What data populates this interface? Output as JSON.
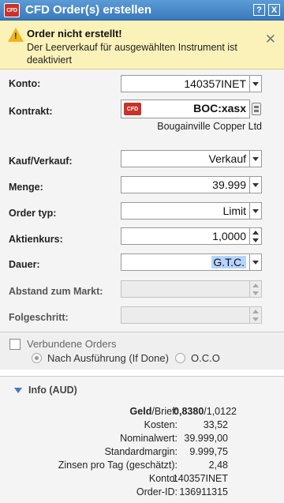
{
  "window": {
    "title": "CFD Order(s) erstellen",
    "app_badge": "CFD",
    "help_btn": "?",
    "close_btn": "X"
  },
  "alert": {
    "title": "Order nicht erstellt!",
    "message": "Der Leerverkauf für ausgewählten Instrument ist deaktiviert",
    "icon": "warning-icon",
    "close": "✕"
  },
  "form": {
    "account_label": "Konto:",
    "account_value": "140357INET",
    "contract_label": "Kontrakt:",
    "contract_badge": "CFD",
    "contract_symbol": "BOC:xasx",
    "contract_name": "Bougainville Copper Ltd",
    "side_label": "Kauf/Verkauf:",
    "side_value": "Verkauf",
    "qty_label": "Menge:",
    "qty_value": "39.999",
    "ordertype_label": "Order typ:",
    "ordertype_value": "Limit",
    "price_label": "Aktienkurs:",
    "price_value": "1,0000",
    "duration_label": "Dauer:",
    "duration_value": "G.T.C.",
    "distance_label": "Abstand zum Markt:",
    "distance_value": "",
    "trailing_label": "Folgeschritt:",
    "trailing_value": ""
  },
  "linked": {
    "label": "Verbundene Orders",
    "option1": "Nach Ausführung (If Done)",
    "option2": "O.C.O"
  },
  "info": {
    "title": "Info (AUD)",
    "bidask_label_bold": "Geld",
    "bidask_label_rest": "/Brief:",
    "bid": "0,8380",
    "ask": "/1,0122",
    "rows": [
      {
        "label": "Kosten:",
        "value": "33,52"
      },
      {
        "label": "Nominalwert:",
        "value": "39.999,00"
      },
      {
        "label": "Standardmargin:",
        "value": "9.999,75"
      },
      {
        "label": "Zinsen pro Tag (geschätzt):",
        "value": "2,48"
      },
      {
        "label": "Konto:",
        "value": "140357INET"
      },
      {
        "label": "Order-ID:",
        "value": "136911315"
      }
    ]
  },
  "colors": {
    "titlebar": "#3a79bd",
    "alert_bg": "#fbf2b9",
    "cfd_red": "#c8322b"
  }
}
